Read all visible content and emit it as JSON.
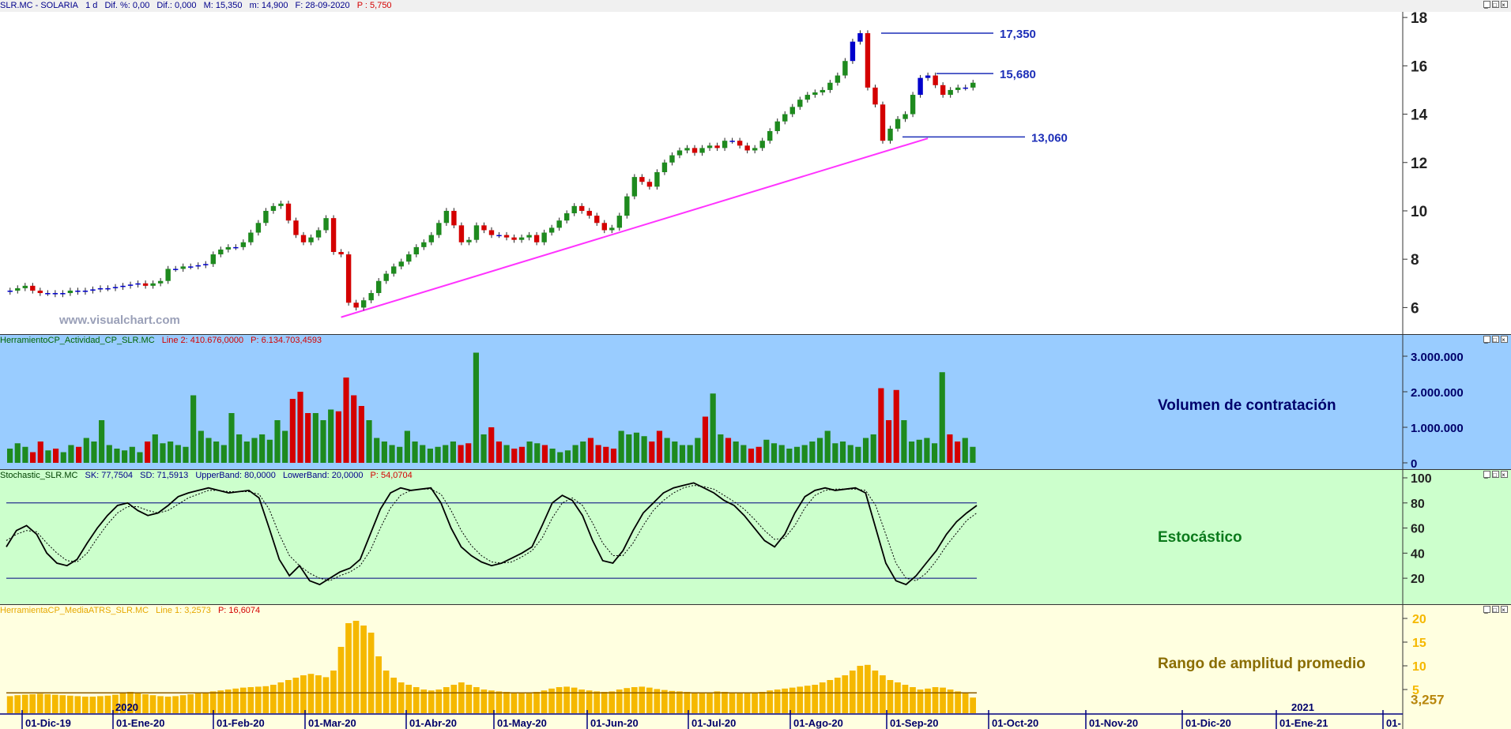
{
  "price_header": {
    "symbol": "SLR.MC - SOLARIA",
    "interval": "1 d",
    "dif_pct": "Dif. %: 0,00",
    "dif": "Dif.: 0,000",
    "max": "M: 15,350",
    "min": "m: 14,900",
    "date": "F: 28-09-2020",
    "price": "P : 5,750"
  },
  "volume_header": {
    "name": "HerramientoCP_Actividad_CP_SLR.MC",
    "line": "Line 2: 410.676,0000",
    "price": "P: 6.134.703,4593"
  },
  "stoch_header": {
    "name": "Stochastic_SLR.MC",
    "sk": "SK: 77,7504",
    "sd": "SD: 71,5913",
    "upper": "UpperBand: 80,0000",
    "lower": "LowerBand: 20,0000",
    "price": "P: 54,0704"
  },
  "atr_header": {
    "name": "HerramientaCP_MediaATRS_SLR.MC",
    "line": "Line 1: 3,2573",
    "price": "P: 16,6074"
  },
  "watermark": "www.visualchart.com",
  "labels": {
    "volume": "Volumen de contratación",
    "stochastic": "Estocástico",
    "atr": "Rango de amplitud promedio",
    "atr_value": "3,257"
  },
  "levels": [
    {
      "text": "17,350",
      "value": 17.35
    },
    {
      "text": "15,680",
      "value": 15.68
    },
    {
      "text": "13,060",
      "value": 13.06
    }
  ],
  "colors": {
    "up": "#1e8a1e",
    "down": "#d40000",
    "doji": "#0000cc",
    "trendline": "#ff33ff",
    "level": "#1d2fb8",
    "volume_bg": "#99ccff",
    "stoch_bg": "#ccffcc",
    "atr_bg": "#ffffe0",
    "atr_bar": "#f5b800"
  },
  "chart_data": [
    {
      "type": "candlestick",
      "title": "SLR.MC - SOLARIA",
      "y_ticks": [
        "6",
        "8",
        "10",
        "12",
        "14",
        "16",
        "18"
      ],
      "ylim": [
        5,
        18.2
      ],
      "x_ticks": [
        "01-Dic-19",
        "01-Ene-20",
        "01-Feb-20",
        "01-Mar-20",
        "01-Abr-20",
        "01-May-20",
        "01-Jun-20",
        "01-Jul-20",
        "01-Ago-20",
        "01-Sep-20",
        "01-Oct-20",
        "01-Nov-20",
        "01-Dic-20",
        "01-Ene-21",
        "01-"
      ],
      "year_markers": [
        "2020",
        "2021"
      ],
      "close": [
        6.7,
        6.8,
        6.9,
        6.7,
        6.6,
        6.6,
        6.55,
        6.6,
        6.7,
        6.65,
        6.7,
        6.75,
        6.8,
        6.8,
        6.85,
        6.9,
        6.95,
        7.0,
        6.9,
        7.0,
        7.1,
        7.6,
        7.6,
        7.7,
        7.7,
        7.75,
        7.8,
        8.2,
        8.4,
        8.5,
        8.5,
        8.7,
        9.1,
        9.5,
        10.0,
        10.2,
        10.3,
        9.6,
        9.0,
        8.7,
        8.9,
        9.2,
        9.7,
        8.3,
        8.2,
        6.2,
        6.0,
        6.3,
        6.6,
        7.1,
        7.4,
        7.7,
        7.9,
        8.2,
        8.5,
        8.7,
        9.0,
        9.5,
        10.0,
        9.4,
        8.7,
        8.8,
        9.4,
        9.2,
        9.0,
        9.0,
        8.9,
        8.8,
        8.9,
        9.0,
        8.7,
        9.1,
        9.3,
        9.6,
        9.9,
        10.2,
        10.0,
        9.8,
        9.5,
        9.2,
        9.3,
        9.8,
        10.6,
        11.4,
        11.2,
        11.0,
        11.6,
        12.0,
        12.3,
        12.5,
        12.6,
        12.4,
        12.6,
        12.7,
        12.6,
        12.9,
        12.9,
        12.7,
        12.5,
        12.6,
        12.9,
        13.3,
        13.7,
        14.0,
        14.3,
        14.6,
        14.8,
        14.9,
        15.0,
        15.3,
        15.6,
        16.2,
        17.0,
        17.35,
        15.1,
        14.4,
        12.9,
        13.4,
        13.8,
        14.0,
        14.8,
        15.5,
        15.6,
        15.2,
        14.8,
        15.0,
        15.1,
        15.1,
        15.3
      ],
      "ohlc_note": "approximate daily closes read from chart; candle colors green=up, red=down, blue=inside/doji",
      "levels": [
        17.35,
        15.68,
        13.06
      ],
      "trendline": {
        "from": {
          "date": "09-Mar-20",
          "value": 5.6
        },
        "to": {
          "date": "25-Sep-20",
          "value": 13.0
        }
      }
    },
    {
      "type": "bar",
      "title": "Volumen de contratación",
      "y_ticks": [
        "0",
        "1.000.000",
        "2.000.000",
        "3.000.000"
      ],
      "ylim": [
        0,
        3200000
      ],
      "values": [
        400000,
        550000,
        450000,
        300000,
        600000,
        350000,
        400000,
        300000,
        500000,
        450000,
        700000,
        600000,
        1200000,
        500000,
        400000,
        350000,
        450000,
        300000,
        600000,
        800000,
        550000,
        600000,
        500000,
        450000,
        1900000,
        900000,
        700000,
        600000,
        500000,
        1400000,
        800000,
        600000,
        700000,
        800000,
        650000,
        1200000,
        900000,
        1800000,
        2000000,
        1400000,
        1400000,
        1200000,
        1500000,
        1450000,
        2400000,
        1900000,
        1600000,
        1200000,
        700000,
        600000,
        500000,
        450000,
        900000,
        600000,
        500000,
        400000,
        450000,
        500000,
        600000,
        500000,
        550000,
        3100000,
        800000,
        1000000,
        600000,
        500000,
        400000,
        450000,
        600000,
        550000,
        500000,
        400000,
        300000,
        350000,
        500000,
        600000,
        700000,
        500000,
        450000,
        400000,
        900000,
        800000,
        850000,
        750000,
        600000,
        900000,
        700000,
        600000,
        500000,
        500000,
        700000,
        1300000,
        1950000,
        800000,
        700000,
        600000,
        500000,
        400000,
        450000,
        650000,
        550000,
        500000,
        400000,
        450000,
        500000,
        600000,
        700000,
        900000,
        550000,
        600000,
        500000,
        450000,
        700000,
        800000,
        2100000,
        1200000,
        2050000,
        1200000,
        600000,
        650000,
        700000,
        550000,
        2550000,
        800000,
        600000,
        700000,
        450000
      ],
      "colors_note": "bar color follows candle direction (green up, red down)"
    },
    {
      "type": "line",
      "title": "Estocástico",
      "y_ticks": [
        "20",
        "40",
        "60",
        "80",
        "100"
      ],
      "ylim": [
        10,
        100
      ],
      "bands": [
        80,
        20
      ],
      "series": [
        {
          "name": "SK",
          "values": [
            45,
            58,
            62,
            55,
            40,
            32,
            30,
            35,
            48,
            60,
            70,
            78,
            80,
            74,
            70,
            72,
            78,
            85,
            88,
            90,
            92,
            90,
            88,
            89,
            90,
            84,
            60,
            35,
            22,
            30,
            18,
            15,
            20,
            25,
            28,
            35,
            55,
            75,
            88,
            92,
            90,
            91,
            92,
            80,
            60,
            45,
            38,
            33,
            30,
            32,
            36,
            40,
            45,
            62,
            80,
            86,
            82,
            70,
            50,
            34,
            32,
            42,
            58,
            72,
            80,
            88,
            92,
            94,
            96,
            92,
            88,
            82,
            78,
            70,
            60,
            50,
            45,
            55,
            72,
            85,
            90,
            92,
            90,
            91,
            92,
            88,
            60,
            32,
            18,
            15,
            22,
            32,
            42,
            55,
            65,
            72,
            78
          ]
        },
        {
          "name": "SD",
          "values": [
            50,
            55,
            58,
            57,
            48,
            40,
            34,
            33,
            40,
            52,
            63,
            72,
            77,
            77,
            74,
            72,
            74,
            79,
            84,
            87,
            90,
            90,
            89,
            89,
            89,
            87,
            75,
            55,
            38,
            30,
            24,
            20,
            18,
            22,
            25,
            30,
            42,
            60,
            76,
            86,
            90,
            91,
            91,
            87,
            74,
            58,
            46,
            38,
            33,
            32,
            33,
            37,
            42,
            52,
            68,
            80,
            84,
            78,
            64,
            48,
            38,
            38,
            48,
            62,
            74,
            82,
            88,
            92,
            94,
            93,
            91,
            86,
            81,
            75,
            67,
            58,
            51,
            52,
            62,
            76,
            86,
            90,
            91,
            91,
            91,
            90,
            78,
            55,
            32,
            20,
            18,
            24,
            34,
            46,
            56,
            66,
            72
          ]
        }
      ]
    },
    {
      "type": "bar",
      "title": "Rango de amplitud promedio",
      "y_ticks": [
        "5",
        "10",
        "15",
        "20"
      ],
      "ylim": [
        0,
        20.5
      ],
      "values": [
        3.6,
        3.8,
        3.9,
        4.0,
        4.1,
        4.0,
        3.9,
        3.8,
        3.7,
        3.6,
        3.5,
        3.5,
        3.6,
        3.7,
        3.9,
        4.2,
        4.5,
        4.3,
        4.0,
        3.8,
        3.6,
        3.5,
        3.6,
        3.8,
        4.0,
        4.2,
        4.4,
        4.6,
        4.8,
        5.0,
        5.2,
        5.4,
        5.5,
        5.6,
        5.7,
        6.0,
        6.5,
        7.0,
        7.5,
        8.0,
        8.3,
        8.0,
        7.6,
        9.0,
        14.0,
        19.0,
        19.5,
        18.5,
        17.0,
        12.0,
        9.0,
        7.5,
        6.5,
        6.0,
        5.5,
        5.0,
        4.8,
        5.0,
        5.5,
        6.0,
        6.5,
        6.0,
        5.5,
        5.0,
        4.8,
        4.6,
        4.5,
        4.4,
        4.3,
        4.4,
        4.5,
        4.8,
        5.2,
        5.5,
        5.6,
        5.4,
        5.0,
        4.8,
        4.6,
        4.5,
        4.6,
        5.0,
        5.3,
        5.5,
        5.6,
        5.4,
        5.1,
        4.9,
        4.7,
        4.6,
        4.5,
        4.4,
        4.3,
        4.4,
        4.6,
        4.5,
        4.4,
        4.3,
        4.2,
        4.3,
        4.5,
        4.8,
        5.0,
        5.2,
        5.4,
        5.6,
        5.8,
        6.0,
        6.5,
        7.0,
        7.5,
        8.0,
        9.0,
        10.0,
        10.2,
        9.0,
        8.0,
        7.0,
        6.5,
        6.0,
        5.5,
        5.0,
        5.2,
        5.5,
        5.4,
        5.0,
        4.6,
        4.2,
        3.3
      ],
      "average_line": 4.3,
      "current_value": 3.257
    }
  ]
}
